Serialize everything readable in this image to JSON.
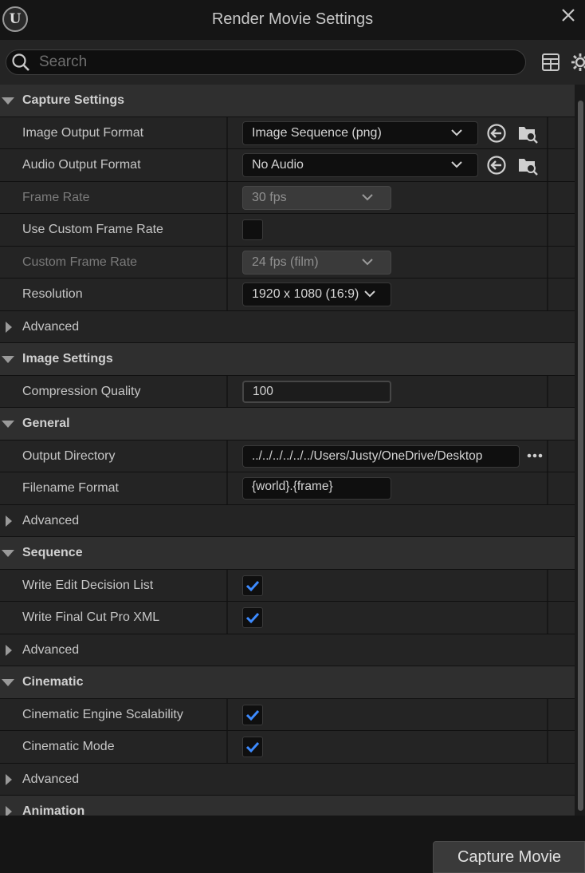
{
  "window": {
    "title": "Render Movie Settings"
  },
  "search": {
    "placeholder": "Search"
  },
  "sections": {
    "capture": {
      "title": "Capture Settings",
      "image_output_format": {
        "label": "Image Output Format",
        "value": "Image Sequence (png)"
      },
      "audio_output_format": {
        "label": "Audio Output Format",
        "value": "No Audio"
      },
      "frame_rate": {
        "label": "Frame Rate",
        "value": "30 fps"
      },
      "use_custom_frame_rate": {
        "label": "Use Custom Frame Rate",
        "checked": false
      },
      "custom_frame_rate": {
        "label": "Custom Frame Rate",
        "value": "24 fps (film)"
      },
      "resolution": {
        "label": "Resolution",
        "value": "1920 x 1080 (16:9)"
      },
      "advanced": "Advanced"
    },
    "image": {
      "title": "Image Settings",
      "compression_quality": {
        "label": "Compression Quality",
        "value": "100"
      }
    },
    "general": {
      "title": "General",
      "output_directory": {
        "label": "Output Directory",
        "value": "../../../../../../Users/Justy/OneDrive/Desktop"
      },
      "filename_format": {
        "label": "Filename Format",
        "value": "{world}.{frame}"
      },
      "advanced": "Advanced"
    },
    "sequence": {
      "title": "Sequence",
      "write_edl": {
        "label": "Write Edit Decision List",
        "checked": true
      },
      "write_fcp_xml": {
        "label": "Write Final Cut Pro XML",
        "checked": true
      },
      "advanced": "Advanced"
    },
    "cinematic": {
      "title": "Cinematic",
      "engine_scalability": {
        "label": "Cinematic Engine Scalability",
        "checked": true
      },
      "cinematic_mode": {
        "label": "Cinematic Mode",
        "checked": true
      },
      "advanced": "Advanced"
    },
    "animation": {
      "title": "Animation"
    }
  },
  "footer": {
    "capture_button": "Capture Movie"
  },
  "colors": {
    "accent_check": "#3d8bff",
    "panel_bg": "#242424",
    "category_bg": "#2f2f2f"
  }
}
